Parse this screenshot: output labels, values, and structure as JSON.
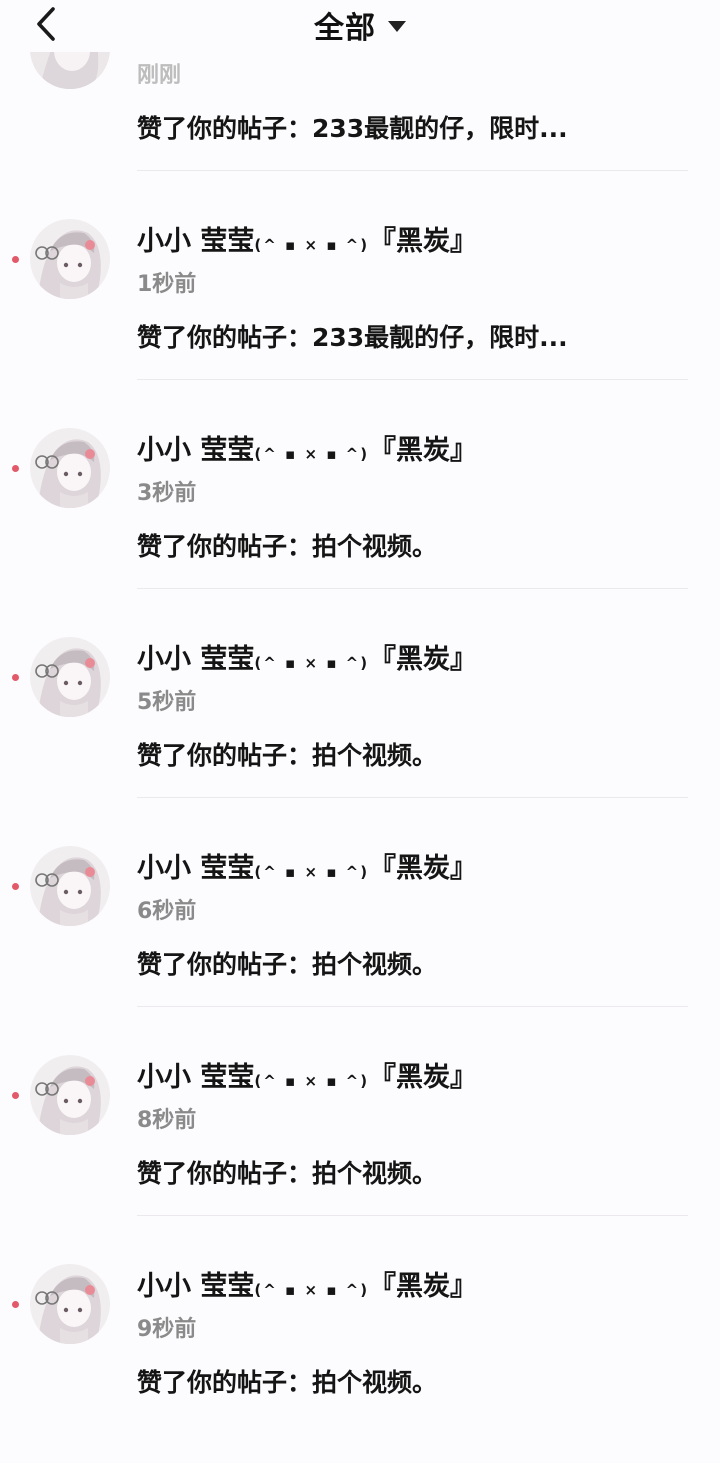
{
  "header": {
    "title": "全部",
    "back_icon": "chevron-left-icon",
    "dropdown_icon": "caret-down-icon"
  },
  "colors": {
    "unread_dot": "#e25a6a",
    "time_text": "#8a8a8a",
    "background": "#fcfbfd"
  },
  "items": [
    {
      "name_main": "",
      "name_suffix": "",
      "name_tail": "",
      "time": "刚刚",
      "content": "赞了你的帖子：233最靓的仔，限时...",
      "unread": false,
      "partial": true
    },
    {
      "name_main": "小小 莹莹",
      "name_suffix": "(^ ▪ × ▪ ^)",
      "name_tail": "『黑炭』",
      "time": "1秒前",
      "content": "赞了你的帖子：233最靓的仔，限时...",
      "unread": true
    },
    {
      "name_main": "小小 莹莹",
      "name_suffix": "(^ ▪ × ▪ ^)",
      "name_tail": "『黑炭』",
      "time": "3秒前",
      "content": "赞了你的帖子：拍个视频。",
      "unread": true
    },
    {
      "name_main": "小小 莹莹",
      "name_suffix": "(^ ▪ × ▪ ^)",
      "name_tail": "『黑炭』",
      "time": "5秒前",
      "content": "赞了你的帖子：拍个视频。",
      "unread": true
    },
    {
      "name_main": "小小 莹莹",
      "name_suffix": "(^ ▪ × ▪ ^)",
      "name_tail": "『黑炭』",
      "time": "6秒前",
      "content": "赞了你的帖子：拍个视频。",
      "unread": true
    },
    {
      "name_main": "小小 莹莹",
      "name_suffix": "(^ ▪ × ▪ ^)",
      "name_tail": "『黑炭』",
      "time": "8秒前",
      "content": "赞了你的帖子：拍个视频。",
      "unread": true
    },
    {
      "name_main": "小小 莹莹",
      "name_suffix": "(^ ▪ × ▪ ^)",
      "name_tail": "『黑炭』",
      "time": "9秒前",
      "content": "赞了你的帖子：拍个视频。",
      "unread": true
    }
  ]
}
